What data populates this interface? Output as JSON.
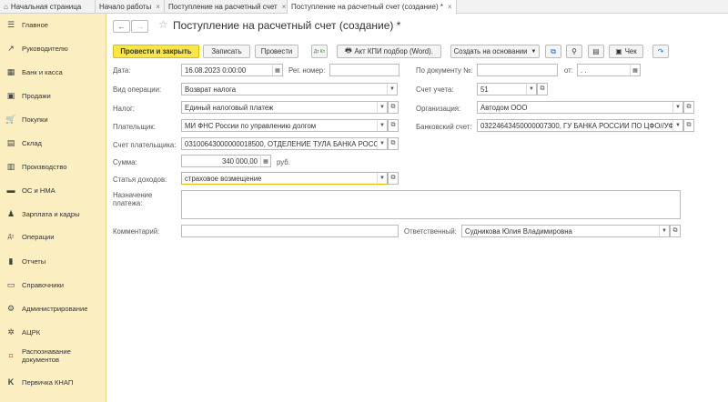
{
  "tabs": [
    {
      "label": "Начальная страница",
      "icon": "home-icon"
    },
    {
      "label": "Начало работы",
      "close": "×"
    },
    {
      "label": "Поступление на расчетный счет",
      "close": "×"
    },
    {
      "label": "Поступление на расчетный счет (создание) *",
      "close": "×"
    }
  ],
  "sidebar": {
    "items": [
      {
        "label": "Главное",
        "icon": "☰"
      },
      {
        "label": "Руководителю",
        "icon": "↗"
      },
      {
        "label": "Банк и касса",
        "icon": "▦"
      },
      {
        "label": "Продажи",
        "icon": "▣"
      },
      {
        "label": "Покупки",
        "icon": "🛒"
      },
      {
        "label": "Склад",
        "icon": "▤"
      },
      {
        "label": "Производство",
        "icon": "▥"
      },
      {
        "label": "ОС и НМА",
        "icon": "▬"
      },
      {
        "label": "Зарплата и кадры",
        "icon": "♟"
      },
      {
        "label": "Операции",
        "icon": "Дт"
      },
      {
        "label": "Отчеты",
        "icon": "▮"
      },
      {
        "label": "Справочники",
        "icon": "▭"
      },
      {
        "label": "Администрирование",
        "icon": "⚙"
      },
      {
        "label": "АЦРК",
        "icon": "✲"
      },
      {
        "label": "Распознавание документов",
        "icon": "⌗"
      },
      {
        "label": "Первичка КНАП",
        "icon": "K"
      }
    ]
  },
  "header": {
    "back": "←",
    "forward": "→",
    "star": "☆",
    "title": "Поступление на расчетный счет (создание) *"
  },
  "toolbar": {
    "post_close": "Провести и закрыть",
    "save": "Записать",
    "post": "Провести",
    "dtkt": "Дт Кт",
    "kpi": "Акт КПИ подбор (Word).",
    "create_based": "Создать на основании",
    "check": "Чек"
  },
  "form": {
    "date_label": "Дата:",
    "date_value": "16.08.2023  0:00:00",
    "reg_label": "Рег. номер:",
    "reg_value": "",
    "docnum_label": "По документу №:",
    "docnum_value": "",
    "from_label": "от:",
    "from_value": " .  .    ",
    "op_label": "Вид операции:",
    "op_value": "Возврат налога",
    "account_label": "Счет учета:",
    "account_value": "51",
    "tax_label": "Налог:",
    "tax_value": "Единый налоговый платеж",
    "org_label": "Организация:",
    "org_value": "Автодом ООО",
    "payer_label": "Плательщик:",
    "payer_value": "МИ ФНС России по управлению долгом",
    "bank_label": "Банковский счет:",
    "bank_value": "03224643450000007300, ГУ БАНКА РОССИИ ПО ЦФО//УФ",
    "payer_acc_label": "Счет плательщика:",
    "payer_acc_value": "03100643000000018500, ОТДЕЛЕНИЕ ТУЛА БАНКА РОСС",
    "sum_label": "Сумма:",
    "sum_value": "340 000,00",
    "currency": "руб.",
    "income_label": "Статья доходов:",
    "income_value": "страховое возмещение",
    "purpose_label": "Назначение платежа:",
    "purpose_value": "",
    "comment_label": "Комментарий:",
    "comment_value": "",
    "resp_label": "Ответственный:",
    "resp_value": "Судникова Юлия Владимировна"
  }
}
